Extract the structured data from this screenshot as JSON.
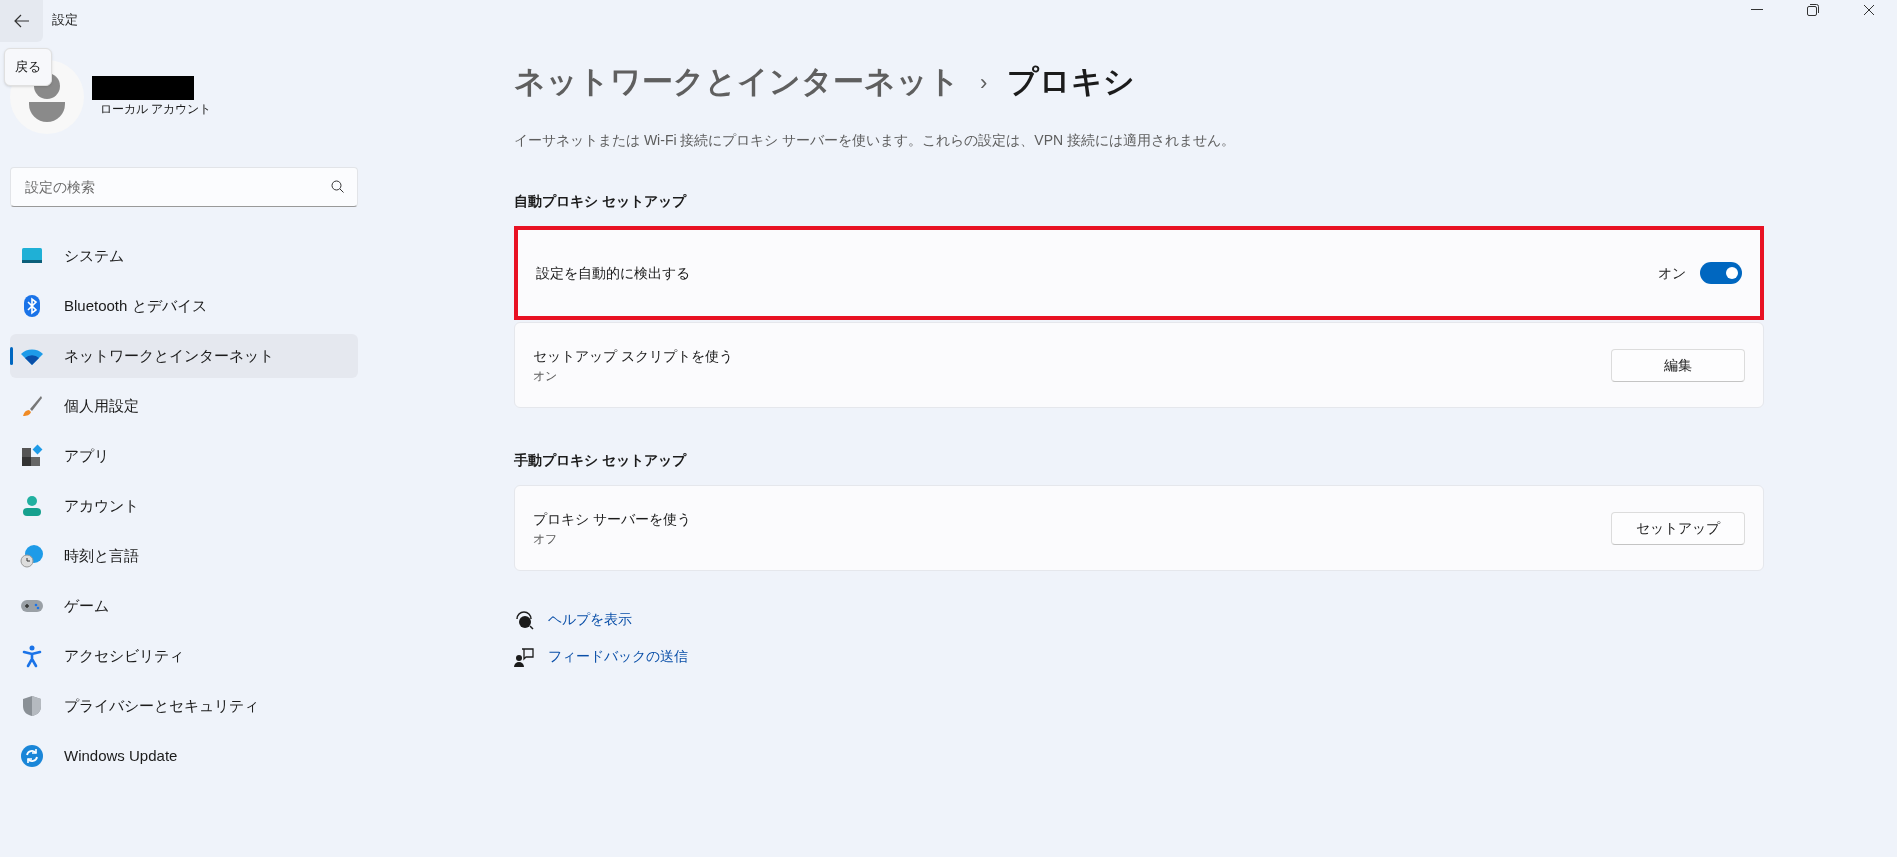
{
  "window": {
    "title": "設定",
    "back_tooltip": "戻る"
  },
  "account": {
    "type": "ローカル アカウント"
  },
  "search": {
    "placeholder": "設定の検索"
  },
  "sidebar": {
    "items": [
      {
        "label": "システム",
        "selected": false
      },
      {
        "label": "Bluetooth とデバイス",
        "selected": false
      },
      {
        "label": "ネットワークとインターネット",
        "selected": true
      },
      {
        "label": "個人用設定",
        "selected": false
      },
      {
        "label": "アプリ",
        "selected": false
      },
      {
        "label": "アカウント",
        "selected": false
      },
      {
        "label": "時刻と言語",
        "selected": false
      },
      {
        "label": "ゲーム",
        "selected": false
      },
      {
        "label": "アクセシビリティ",
        "selected": false
      },
      {
        "label": "プライバシーとセキュリティ",
        "selected": false
      },
      {
        "label": "Windows Update",
        "selected": false
      }
    ]
  },
  "breadcrumb": {
    "parent": "ネットワークとインターネット",
    "separator": "›",
    "current": "プロキシ"
  },
  "description": "イーサネットまたは Wi-Fi 接続にプロキシ サーバーを使います。これらの設定は、VPN 接続には適用されません。",
  "sections": [
    {
      "title": "自動プロキシ セットアップ",
      "rows": [
        {
          "kind": "toggle",
          "label": "設定を自動的に検出する",
          "state_label": "オン",
          "on": true,
          "highlighted": true
        },
        {
          "kind": "button",
          "label": "セットアップ スクリプトを使う",
          "status": "オン",
          "button": "編集",
          "highlighted": false
        }
      ]
    },
    {
      "title": "手動プロキシ セットアップ",
      "rows": [
        {
          "kind": "button",
          "label": "プロキシ サーバーを使う",
          "status": "オフ",
          "button": "セットアップ",
          "highlighted": false
        }
      ]
    }
  ],
  "links": [
    "ヘルプを表示",
    "フィードバックの送信"
  ]
}
